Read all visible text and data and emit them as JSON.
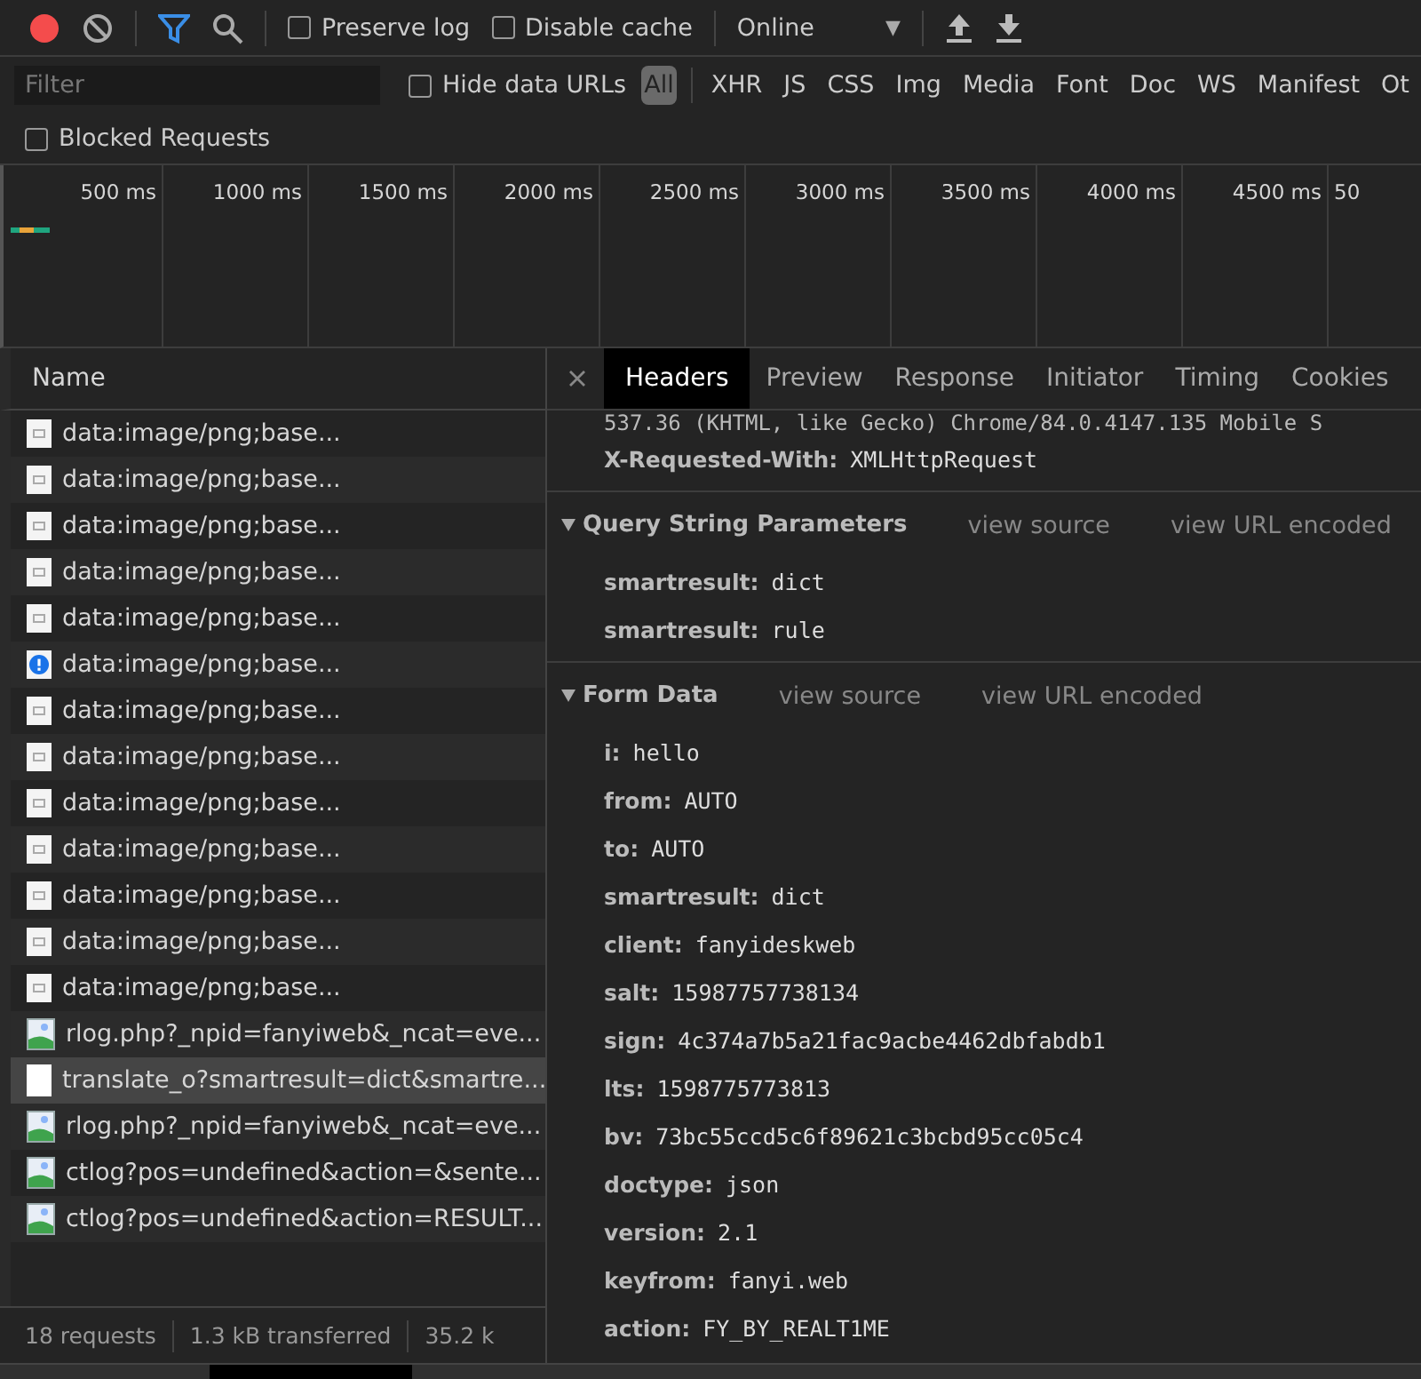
{
  "toolbar": {
    "recording": true,
    "preserve_log": {
      "label": "Preserve log",
      "checked": false
    },
    "disable_cache": {
      "label": "Disable cache",
      "checked": false
    },
    "throttling": "Online",
    "throttling_caret": "▼"
  },
  "filter_bar": {
    "placeholder": "Filter",
    "hide_data_urls": {
      "label": "Hide data URLs",
      "checked": false
    },
    "types": [
      {
        "label": "All",
        "selected": true
      },
      {
        "label": "XHR",
        "selected": false
      },
      {
        "label": "JS",
        "selected": false
      },
      {
        "label": "CSS",
        "selected": false
      },
      {
        "label": "Img",
        "selected": false
      },
      {
        "label": "Media",
        "selected": false
      },
      {
        "label": "Font",
        "selected": false
      },
      {
        "label": "Doc",
        "selected": false
      },
      {
        "label": "WS",
        "selected": false
      },
      {
        "label": "Manifest",
        "selected": false
      },
      {
        "label": "Ot",
        "selected": false
      }
    ],
    "blocked_requests": {
      "label": "Blocked Requests",
      "checked": false
    }
  },
  "timeline": {
    "ticks": [
      "500 ms",
      "1000 ms",
      "1500 ms",
      "2000 ms",
      "2500 ms",
      "3000 ms",
      "3500 ms",
      "4000 ms",
      "4500 ms",
      "50"
    ]
  },
  "requests": {
    "column": "Name",
    "rows": [
      {
        "name": "data:image/png;base...",
        "kind": "thumbnail",
        "selected": false
      },
      {
        "name": "data:image/png;base...",
        "kind": "thumbnail",
        "selected": false
      },
      {
        "name": "data:image/png;base...",
        "kind": "thumbnail",
        "selected": false
      },
      {
        "name": "data:image/png;base...",
        "kind": "thumbnail",
        "selected": false
      },
      {
        "name": "data:image/png;base...",
        "kind": "thumbnail",
        "selected": false
      },
      {
        "name": "data:image/png;base...",
        "kind": "info",
        "selected": false
      },
      {
        "name": "data:image/png;base...",
        "kind": "thumbnail",
        "selected": false
      },
      {
        "name": "data:image/png;base...",
        "kind": "thumbnail",
        "selected": false
      },
      {
        "name": "data:image/png;base...",
        "kind": "thumbnail",
        "selected": false
      },
      {
        "name": "data:image/png;base...",
        "kind": "thumbnail",
        "selected": false
      },
      {
        "name": "data:image/png;base...",
        "kind": "thumbnail",
        "selected": false
      },
      {
        "name": "data:image/png;base...",
        "kind": "thumbnail",
        "selected": false
      },
      {
        "name": "data:image/png;base...",
        "kind": "thumbnail",
        "selected": false
      },
      {
        "name": "rlog.php?_npid=fanyiweb&_ncat=eve...",
        "kind": "image",
        "selected": false
      },
      {
        "name": "translate_o?smartresult=dict&smartre...",
        "kind": "document",
        "selected": true
      },
      {
        "name": "rlog.php?_npid=fanyiweb&_ncat=eve...",
        "kind": "image",
        "selected": false
      },
      {
        "name": "ctlog?pos=undefined&action=&sente...",
        "kind": "image",
        "selected": false
      },
      {
        "name": "ctlog?pos=undefined&action=RESULT...",
        "kind": "image",
        "selected": false
      }
    ]
  },
  "status_bar": [
    "18 requests",
    "1.3 kB transferred",
    "35.2 k"
  ],
  "detail": {
    "tabs": [
      {
        "label": "Headers",
        "selected": true
      },
      {
        "label": "Preview",
        "selected": false
      },
      {
        "label": "Response",
        "selected": false
      },
      {
        "label": "Initiator",
        "selected": false
      },
      {
        "label": "Timing",
        "selected": false
      },
      {
        "label": "Cookies",
        "selected": false
      }
    ],
    "value_fragment": "537.36 (KHTML, like Gecko) Chrome/84.0.4147.135 Mobile S",
    "headers": [
      {
        "key": "X-Requested-With:",
        "value": "XMLHttpRequest"
      }
    ],
    "sections": [
      {
        "title": "Query String Parameters",
        "expanded": true,
        "links": [
          "view source",
          "view URL encoded"
        ],
        "params": [
          {
            "key": "smartresult:",
            "value": "dict"
          },
          {
            "key": "smartresult:",
            "value": "rule"
          }
        ]
      },
      {
        "title": "Form Data",
        "expanded": true,
        "links": [
          "view source",
          "view URL encoded"
        ],
        "params": [
          {
            "key": "i:",
            "value": "hello"
          },
          {
            "key": "from:",
            "value": "AUTO"
          },
          {
            "key": "to:",
            "value": "AUTO"
          },
          {
            "key": "smartresult:",
            "value": "dict"
          },
          {
            "key": "client:",
            "value": "fanyideskweb"
          },
          {
            "key": "salt:",
            "value": "15987757738134"
          },
          {
            "key": "sign:",
            "value": "4c374a7b5a21fac9acbe4462dbfabdb1"
          },
          {
            "key": "lts:",
            "value": "1598775773813"
          },
          {
            "key": "bv:",
            "value": "73bc55ccd5c6f89621c3bcbd95cc05c4"
          },
          {
            "key": "doctype:",
            "value": "json"
          },
          {
            "key": "version:",
            "value": "2.1"
          },
          {
            "key": "keyfrom:",
            "value": "fanyi.web"
          },
          {
            "key": "action:",
            "value": "FY_BY_REALT1ME"
          }
        ]
      }
    ]
  }
}
